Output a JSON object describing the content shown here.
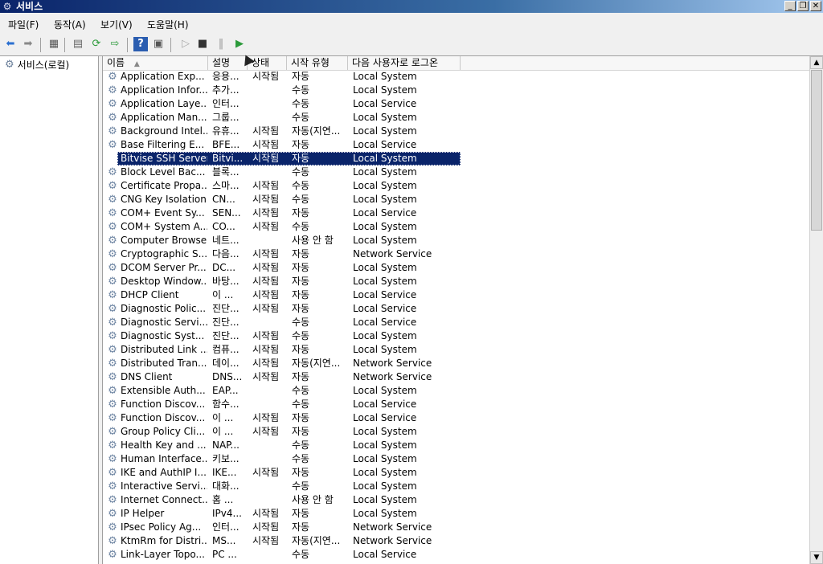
{
  "window": {
    "title": "서비스",
    "buttons": {
      "minimize": "_",
      "restore": "❐",
      "close": "✕"
    }
  },
  "menu": [
    "파일(F)",
    "동작(A)",
    "보기(V)",
    "도움말(H)"
  ],
  "toolbar": {
    "icons": [
      "back-arrow-icon",
      "forward-arrow-icon",
      "show-hide-console-tree-icon",
      "properties-icon",
      "refresh-icon",
      "export-list-icon",
      "help-icon",
      "show-hide-action-pane-icon",
      "start-service-icon",
      "stop-service-icon",
      "pause-service-icon",
      "restart-service-icon"
    ]
  },
  "tree": {
    "root": "서비스(로컬)"
  },
  "columns": {
    "name": "이름",
    "desc": "설명",
    "state": "상태",
    "type": "시작 유형",
    "logon": "다음 사용자로 로그온"
  },
  "selected_index": 6,
  "rows": [
    {
      "name": "Application Exp...",
      "desc": "응용...",
      "state": "시작됨",
      "type": "자동",
      "logon": "Local System"
    },
    {
      "name": "Application Infor...",
      "desc": "추가...",
      "state": "",
      "type": "수동",
      "logon": "Local System"
    },
    {
      "name": "Application Laye...",
      "desc": "인터...",
      "state": "",
      "type": "수동",
      "logon": "Local Service"
    },
    {
      "name": "Application Man...",
      "desc": "그룹...",
      "state": "",
      "type": "수동",
      "logon": "Local System"
    },
    {
      "name": "Background Intel...",
      "desc": "유휴...",
      "state": "시작됨",
      "type": "자동(지연...",
      "logon": "Local System"
    },
    {
      "name": "Base Filtering E...",
      "desc": "BFE...",
      "state": "시작됨",
      "type": "자동",
      "logon": "Local Service"
    },
    {
      "name": "Bitvise SSH Server",
      "desc": "Bitvi...",
      "state": "시작됨",
      "type": "자동",
      "logon": "Local System"
    },
    {
      "name": "Block Level Bac...",
      "desc": "블록...",
      "state": "",
      "type": "수동",
      "logon": "Local System"
    },
    {
      "name": "Certificate Propa...",
      "desc": "스마...",
      "state": "시작됨",
      "type": "수동",
      "logon": "Local System"
    },
    {
      "name": "CNG Key Isolation",
      "desc": "CN...",
      "state": "시작됨",
      "type": "수동",
      "logon": "Local System"
    },
    {
      "name": "COM+ Event Sy...",
      "desc": "SEN...",
      "state": "시작됨",
      "type": "자동",
      "logon": "Local Service"
    },
    {
      "name": "COM+ System A...",
      "desc": "CO...",
      "state": "시작됨",
      "type": "수동",
      "logon": "Local System"
    },
    {
      "name": "Computer Browser",
      "desc": "네트...",
      "state": "",
      "type": "사용 안 함",
      "logon": "Local System"
    },
    {
      "name": "Cryptographic S...",
      "desc": "다음...",
      "state": "시작됨",
      "type": "자동",
      "logon": "Network Service"
    },
    {
      "name": "DCOM Server Pr...",
      "desc": "DC...",
      "state": "시작됨",
      "type": "자동",
      "logon": "Local System"
    },
    {
      "name": "Desktop Window...",
      "desc": "바탕...",
      "state": "시작됨",
      "type": "자동",
      "logon": "Local System"
    },
    {
      "name": "DHCP Client",
      "desc": "이 ...",
      "state": "시작됨",
      "type": "자동",
      "logon": "Local Service"
    },
    {
      "name": "Diagnostic Polic...",
      "desc": "진단...",
      "state": "시작됨",
      "type": "자동",
      "logon": "Local Service"
    },
    {
      "name": "Diagnostic Servi...",
      "desc": "진단...",
      "state": "",
      "type": "수동",
      "logon": "Local Service"
    },
    {
      "name": "Diagnostic Syst...",
      "desc": "진단...",
      "state": "시작됨",
      "type": "수동",
      "logon": "Local System"
    },
    {
      "name": "Distributed Link ...",
      "desc": "컴퓨...",
      "state": "시작됨",
      "type": "자동",
      "logon": "Local System"
    },
    {
      "name": "Distributed Tran...",
      "desc": "데이...",
      "state": "시작됨",
      "type": "자동(지연...",
      "logon": "Network Service"
    },
    {
      "name": "DNS Client",
      "desc": "DNS...",
      "state": "시작됨",
      "type": "자동",
      "logon": "Network Service"
    },
    {
      "name": "Extensible Auth...",
      "desc": "EAP...",
      "state": "",
      "type": "수동",
      "logon": "Local System"
    },
    {
      "name": "Function Discov...",
      "desc": "함수...",
      "state": "",
      "type": "수동",
      "logon": "Local Service"
    },
    {
      "name": "Function Discov...",
      "desc": "이 ...",
      "state": "시작됨",
      "type": "자동",
      "logon": "Local Service"
    },
    {
      "name": "Group Policy Cli...",
      "desc": "이 ...",
      "state": "시작됨",
      "type": "자동",
      "logon": "Local System"
    },
    {
      "name": "Health Key and ...",
      "desc": "NAP...",
      "state": "",
      "type": "수동",
      "logon": "Local System"
    },
    {
      "name": "Human Interface...",
      "desc": "키보...",
      "state": "",
      "type": "수동",
      "logon": "Local System"
    },
    {
      "name": "IKE and AuthIP I...",
      "desc": "IKE...",
      "state": "시작됨",
      "type": "자동",
      "logon": "Local System"
    },
    {
      "name": "Interactive Servi...",
      "desc": "대화...",
      "state": "",
      "type": "수동",
      "logon": "Local System"
    },
    {
      "name": "Internet Connect...",
      "desc": "홈 ...",
      "state": "",
      "type": "사용 안 함",
      "logon": "Local System"
    },
    {
      "name": "IP Helper",
      "desc": "IPv4...",
      "state": "시작됨",
      "type": "자동",
      "logon": "Local System"
    },
    {
      "name": "IPsec Policy Ag...",
      "desc": "인터...",
      "state": "시작됨",
      "type": "자동",
      "logon": "Network Service"
    },
    {
      "name": "KtmRm for Distri...",
      "desc": "MS...",
      "state": "시작됨",
      "type": "자동(지연...",
      "logon": "Network Service"
    },
    {
      "name": "Link-Layer Topo...",
      "desc": "PC ...",
      "state": "",
      "type": "수동",
      "logon": "Local Service"
    }
  ]
}
